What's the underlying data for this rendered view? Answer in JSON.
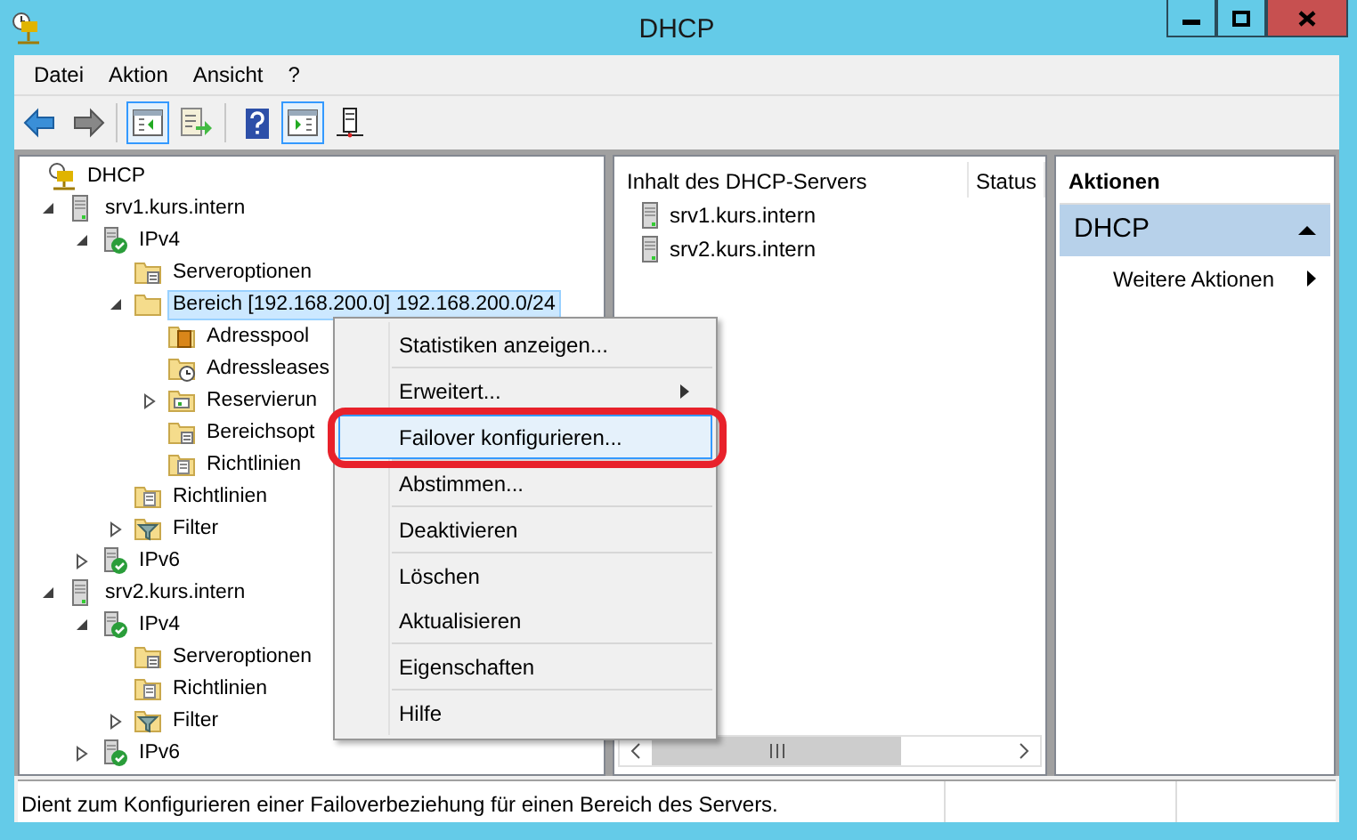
{
  "window": {
    "title": "DHCP"
  },
  "menu_bar": [
    "Datei",
    "Aktion",
    "Ansicht",
    "?"
  ],
  "toolbar": [
    {
      "kind": "back",
      "pressed": false
    },
    {
      "kind": "forward",
      "pressed": false
    },
    {
      "kind": "separator"
    },
    {
      "kind": "tree-toggle",
      "pressed": true
    },
    {
      "kind": "export",
      "pressed": false
    },
    {
      "kind": "separator"
    },
    {
      "kind": "help",
      "pressed": false
    },
    {
      "kind": "action-pane",
      "pressed": true
    },
    {
      "kind": "server",
      "pressed": false
    }
  ],
  "tree": [
    {
      "label": "DHCP",
      "kind": "dhcp",
      "selected": false,
      "children": [
        {
          "label": "srv1.kurs.intern",
          "kind": "server",
          "expanded": true,
          "selected": false,
          "children": [
            {
              "label": "IPv4",
              "kind": "ip",
              "expanded": true,
              "selected": false,
              "children": [
                {
                  "label": "Serveroptionen",
                  "kind": "options",
                  "selected": false
                },
                {
                  "label": "Bereich [192.168.200.0] 192.168.200.0/24",
                  "kind": "folder",
                  "expanded": true,
                  "selected": true,
                  "children": [
                    {
                      "label": "Adresspool",
                      "kind": "pool",
                      "selected": false
                    },
                    {
                      "label": "Adressleases",
                      "kind": "leases",
                      "selected": false
                    },
                    {
                      "label": "Reservierun",
                      "kind": "reservations",
                      "expanded": false,
                      "selected": false
                    },
                    {
                      "label": "Bereichsopt",
                      "kind": "options",
                      "selected": false
                    },
                    {
                      "label": "Richtlinien",
                      "kind": "policy",
                      "selected": false
                    }
                  ]
                },
                {
                  "label": "Richtlinien",
                  "kind": "policy",
                  "selected": false
                },
                {
                  "label": "Filter",
                  "kind": "filter",
                  "expanded": false,
                  "selected": false
                }
              ]
            },
            {
              "label": "IPv6",
              "kind": "ip",
              "expanded": false,
              "selected": false
            }
          ]
        },
        {
          "label": "srv2.kurs.intern",
          "kind": "server",
          "expanded": true,
          "selected": false,
          "children": [
            {
              "label": "IPv4",
              "kind": "ip",
              "expanded": true,
              "selected": false,
              "children": [
                {
                  "label": "Serveroptionen",
                  "kind": "options",
                  "selected": false
                },
                {
                  "label": "Richtlinien",
                  "kind": "policy",
                  "selected": false
                },
                {
                  "label": "Filter",
                  "kind": "filter",
                  "expanded": false,
                  "selected": false
                }
              ]
            },
            {
              "label": "IPv6",
              "kind": "ip",
              "expanded": false,
              "selected": false
            }
          ]
        }
      ]
    }
  ],
  "context_menu": [
    {
      "label": "Statistiken anzeigen...",
      "selected": false,
      "submenu": false,
      "separator_after": true,
      "annotated": false
    },
    {
      "label": "Erweitert...",
      "selected": false,
      "submenu": true,
      "separator_after": true,
      "annotated": false
    },
    {
      "label": "Failover konfigurieren...",
      "selected": true,
      "submenu": false,
      "separator_after": true,
      "annotated": true
    },
    {
      "label": "Abstimmen...",
      "selected": false,
      "submenu": false,
      "separator_after": true,
      "annotated": false
    },
    {
      "label": "Deaktivieren",
      "selected": false,
      "submenu": false,
      "separator_after": true,
      "annotated": false
    },
    {
      "label": "Löschen",
      "selected": false,
      "submenu": false,
      "separator_after": false,
      "annotated": false
    },
    {
      "label": "Aktualisieren",
      "selected": false,
      "submenu": false,
      "separator_after": true,
      "annotated": false
    },
    {
      "label": "Eigenschaften",
      "selected": false,
      "submenu": false,
      "separator_after": true,
      "annotated": false
    },
    {
      "label": "Hilfe",
      "selected": false,
      "submenu": false,
      "separator_after": false,
      "annotated": false
    }
  ],
  "content": {
    "columns": [
      "Inhalt des DHCP-Servers",
      "Status"
    ],
    "rows": [
      {
        "name": "srv1.kurs.intern"
      },
      {
        "name": "srv2.kurs.intern"
      }
    ]
  },
  "actions": {
    "title": "Aktionen",
    "section": "DHCP",
    "items": [
      {
        "label": "Weitere Aktionen",
        "submenu": true
      }
    ]
  },
  "status_bar": "Dient zum Konfigurieren einer Failoverbeziehung für einen Bereich des Servers."
}
